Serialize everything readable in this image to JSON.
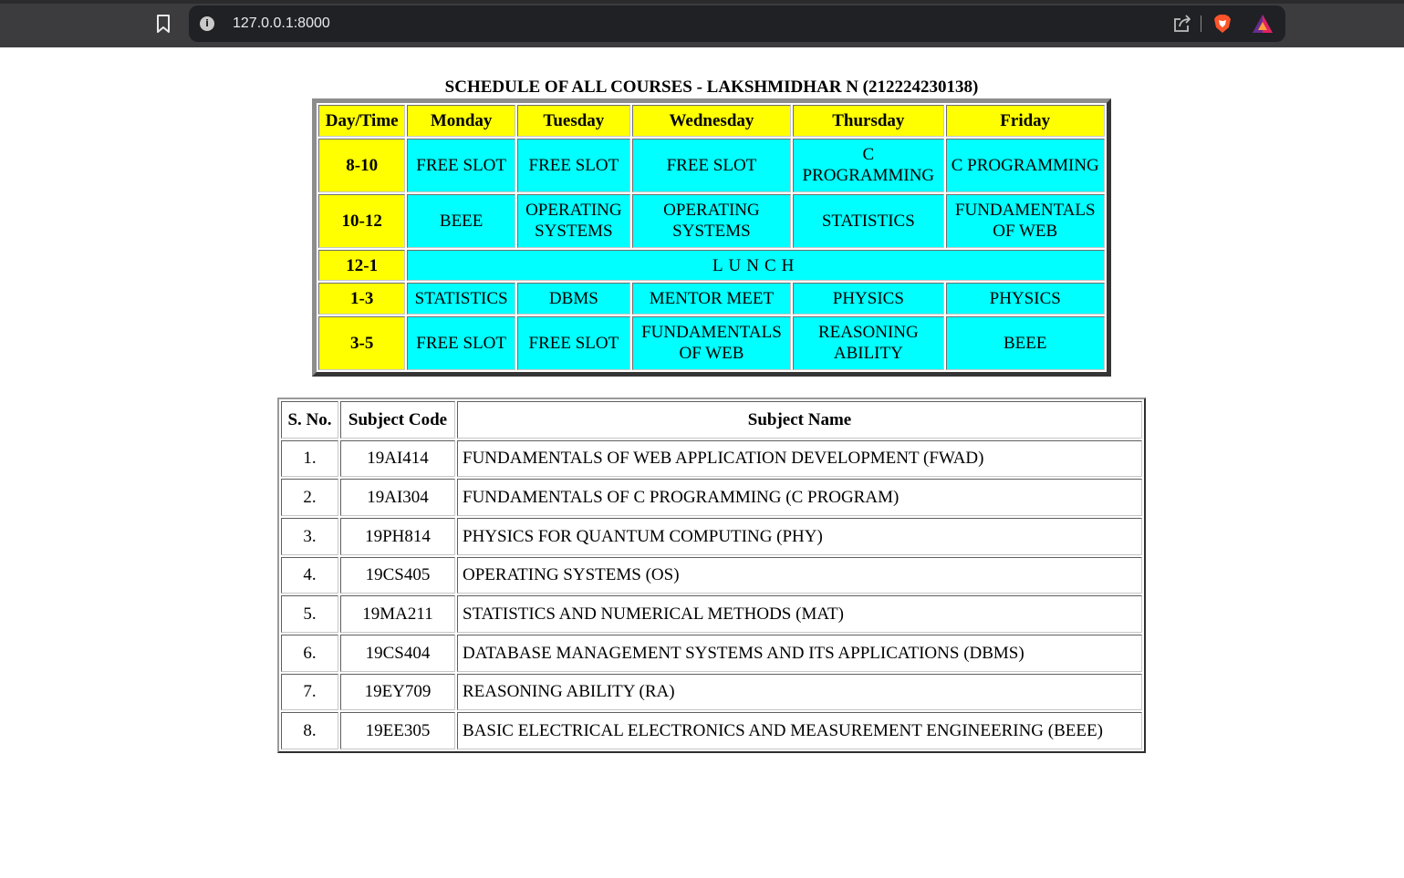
{
  "browser": {
    "url": "127.0.0.1:8000",
    "icons": [
      "bookmark-icon",
      "info-icon",
      "share-icon",
      "brave-shield-icon",
      "brave-rewards-icon"
    ]
  },
  "page": {
    "title": "SCHEDULE OF ALL COURSES - LAKSHMIDHAR N (212224230138)"
  },
  "schedule": {
    "headers": [
      "Day/Time",
      "Monday",
      "Tuesday",
      "Wednesday",
      "Thursday",
      "Friday"
    ],
    "rows": [
      {
        "time": "8-10",
        "cells": [
          "FREE SLOT",
          "FREE SLOT",
          "FREE SLOT",
          "C PROGRAMMING",
          "C PROGRAMMING"
        ]
      },
      {
        "time": "10-12",
        "cells": [
          "BEEE",
          "OPERATING SYSTEMS",
          "OPERATING SYSTEMS",
          "STATISTICS",
          "FUNDAMENTALS OF WEB"
        ]
      },
      {
        "time": "12-1",
        "lunch": "LUNCH"
      },
      {
        "time": "1-3",
        "cells": [
          "STATISTICS",
          "DBMS",
          "MENTOR MEET",
          "PHYSICS",
          "PHYSICS"
        ]
      },
      {
        "time": "3-5",
        "cells": [
          "FREE SLOT",
          "FREE SLOT",
          "FUNDAMENTALS OF WEB",
          "REASONING ABILITY",
          "BEEE"
        ]
      }
    ],
    "colors": {
      "header": "#ffff00",
      "cell": "#00ffff"
    }
  },
  "subjects": {
    "headers": [
      "S. No.",
      "Subject Code",
      "Subject Name"
    ],
    "rows": [
      {
        "sno": "1.",
        "code": "19AI414",
        "name": "FUNDAMENTALS OF WEB APPLICATION DEVELOPMENT (FWAD)"
      },
      {
        "sno": "2.",
        "code": "19AI304",
        "name": "FUNDAMENTALS OF C PROGRAMMING (C PROGRAM)"
      },
      {
        "sno": "3.",
        "code": "19PH814",
        "name": "PHYSICS FOR QUANTUM COMPUTING (PHY)"
      },
      {
        "sno": "4.",
        "code": "19CS405",
        "name": "OPERATING SYSTEMS (OS)"
      },
      {
        "sno": "5.",
        "code": "19MA211",
        "name": "STATISTICS AND NUMERICAL METHODS (MAT)"
      },
      {
        "sno": "6.",
        "code": "19CS404",
        "name": "DATABASE MANAGEMENT SYSTEMS AND ITS APPLICATIONS (DBMS)"
      },
      {
        "sno": "7.",
        "code": "19EY709",
        "name": "REASONING ABILITY (RA)"
      },
      {
        "sno": "8.",
        "code": "19EE305",
        "name": "BASIC ELECTRICAL ELECTRONICS AND MEASUREMENT ENGINEERING (BEEE)"
      }
    ]
  }
}
